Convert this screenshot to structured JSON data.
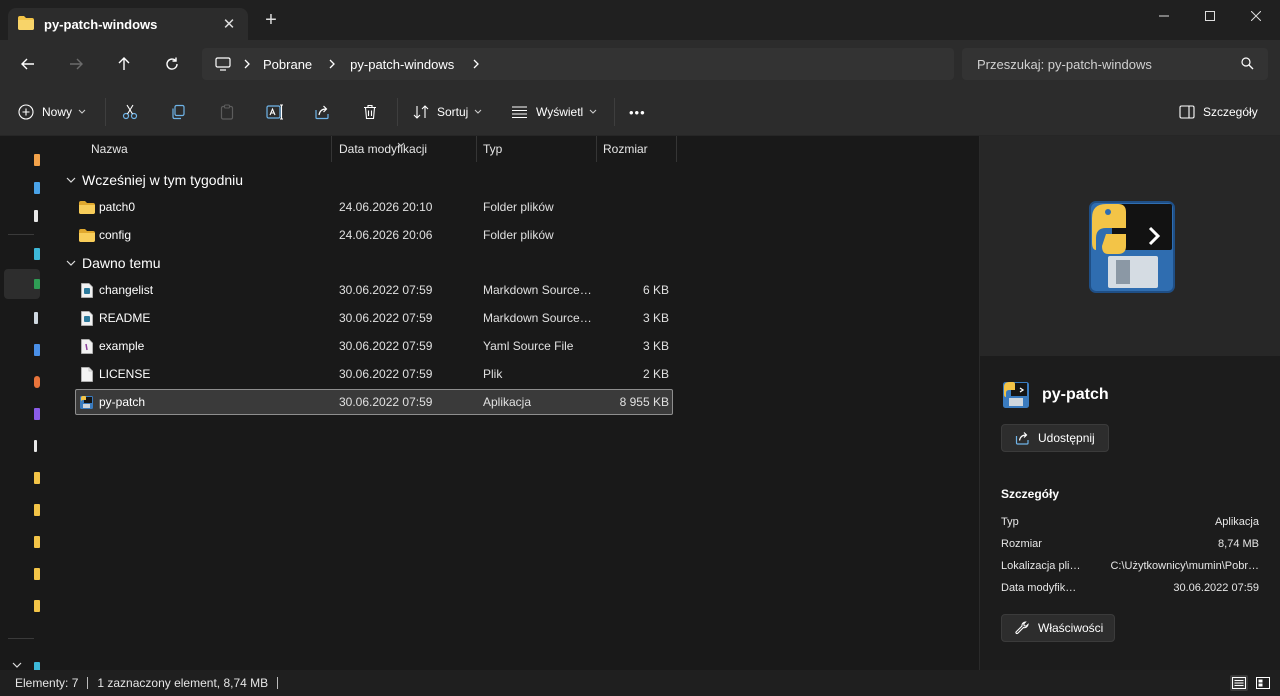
{
  "window": {
    "tab_title": "py-patch-windows",
    "new_tab_symbol": "+",
    "close_tab_symbol": "✕"
  },
  "nav": {
    "breadcrumb": [
      "Pobrane",
      "py-patch-windows"
    ],
    "search_placeholder": "Przeszukaj: py-patch-windows"
  },
  "toolbar": {
    "new_label": "Nowy",
    "sort_label": "Sortuj",
    "view_label": "Wyświetl",
    "more_symbol": "•••",
    "details_label": "Szczegóły"
  },
  "columns": {
    "name": "Nazwa",
    "date": "Data modyfikacji",
    "type": "Typ",
    "size": "Rozmiar"
  },
  "groups": [
    {
      "title": "Wcześniej w tym tygodniu",
      "items": [
        {
          "name": "patch0",
          "date": "24.06.2026 20:10",
          "type": "Folder plików",
          "size": "",
          "icon": "folder-icon"
        },
        {
          "name": "config",
          "date": "24.06.2026 20:06",
          "type": "Folder plików",
          "size": "",
          "icon": "folder-icon"
        }
      ]
    },
    {
      "title": "Dawno temu",
      "items": [
        {
          "name": "changelist",
          "date": "30.06.2022 07:59",
          "type": "Markdown Source…",
          "size": "6 KB",
          "icon": "markdown-file-icon"
        },
        {
          "name": "README",
          "date": "30.06.2022 07:59",
          "type": "Markdown Source…",
          "size": "3 KB",
          "icon": "markdown-file-icon"
        },
        {
          "name": "example",
          "date": "30.06.2022 07:59",
          "type": "Yaml Source File",
          "size": "3 KB",
          "icon": "yaml-file-icon"
        },
        {
          "name": "LICENSE",
          "date": "30.06.2022 07:59",
          "type": "Plik",
          "size": "2 KB",
          "icon": "file-icon"
        },
        {
          "name": "py-patch",
          "date": "30.06.2022 07:59",
          "type": "Aplikacja",
          "size": "8 955 KB",
          "icon": "python-app-icon",
          "selected": true
        }
      ]
    }
  ],
  "details": {
    "title": "py-patch",
    "share_label": "Udostępnij",
    "section_title": "Szczegóły",
    "rows": [
      {
        "key": "Typ",
        "value": "Aplikacja"
      },
      {
        "key": "Rozmiar",
        "value": "8,74 MB"
      },
      {
        "key": "Lokalizacja pli…",
        "value": "C:\\Użytkownicy\\mumin\\Pobr…"
      },
      {
        "key": "Data modyfik…",
        "value": "30.06.2022 07:59"
      }
    ],
    "properties_label": "Właściwości"
  },
  "status": {
    "items_count": "Elementy: 7",
    "selection": "1 zaznaczony element, 8,74 MB"
  },
  "colors": {
    "folder": "#f3c447",
    "accent_selection": "#3a3a3a",
    "background": "#191919"
  }
}
